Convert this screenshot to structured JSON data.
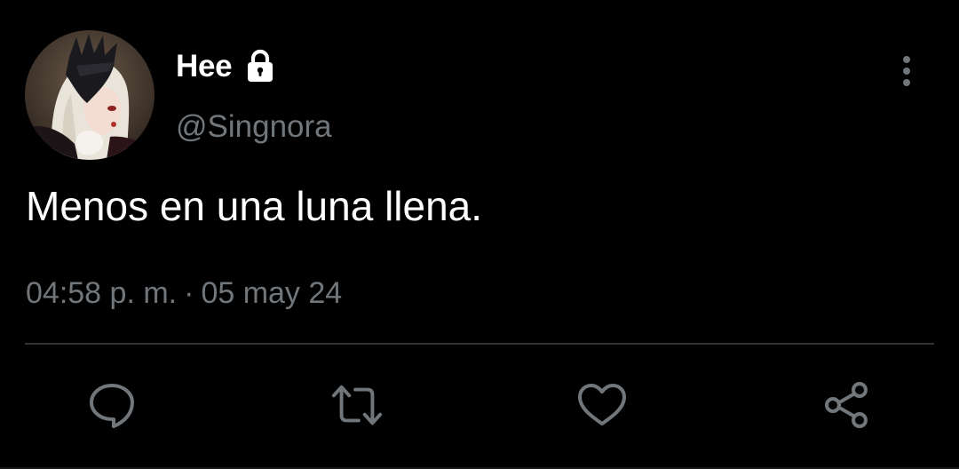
{
  "tweet": {
    "author": {
      "display_name": "Hee",
      "handle": "@Singnora",
      "avatar_icon": "avatar-image",
      "protected_icon": "lock-icon"
    },
    "text": "Menos en una luna llena.",
    "time": "04:58 p. m.",
    "separator": "·",
    "date": "05 may 24"
  },
  "actions": {
    "reply_icon": "reply-icon",
    "retweet_icon": "retweet-icon",
    "like_icon": "heart-icon",
    "share_icon": "share-icon",
    "more_icon": "more-vertical-icon"
  },
  "colors": {
    "background": "#000000",
    "primary_text": "#ffffff",
    "secondary_text": "#71767b",
    "divider": "#2f3336",
    "icon": "#71767b"
  }
}
